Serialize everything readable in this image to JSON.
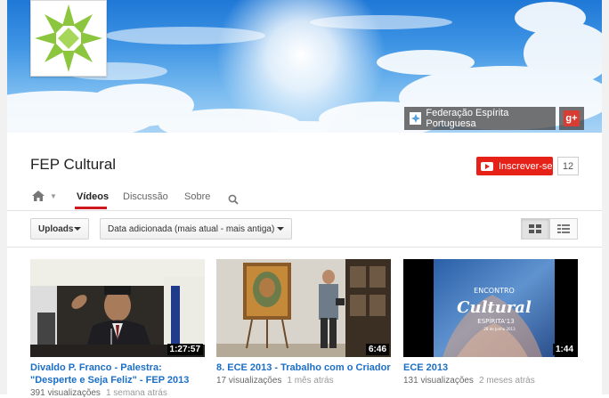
{
  "banner": {
    "link_label": "Federação Espírita Portuguesa",
    "gplus_label": "g+"
  },
  "channel": {
    "title": "FEP Cultural",
    "subscribe_label": "Inscrever-se",
    "subscriber_count": "12"
  },
  "tabs": {
    "items": [
      {
        "label": "Vídeos",
        "active": true
      },
      {
        "label": "Discussão",
        "active": false
      },
      {
        "label": "Sobre",
        "active": false
      }
    ]
  },
  "toolbar": {
    "uploads_label": "Uploads",
    "sort_label": "Data adicionada (mais atual - mais antiga)"
  },
  "videos": [
    {
      "title": "Divaldo P. Franco - Palestra: \"Desperte e Seja Feliz\" - FEP 2013",
      "duration": "1:27:57",
      "views": "391 visualizações",
      "age": "1 semana atrás"
    },
    {
      "title": "8. ECE 2013 - Trabalho com o Criador",
      "duration": "6:46",
      "views": "17 visualizações",
      "age": "1 mês atrás"
    },
    {
      "title": "ECE 2013",
      "duration": "1:44",
      "views": "131 visualizações",
      "age": "2 meses atrás",
      "thumb_text": {
        "line1": "ENCONTRO",
        "line2": "Cultural",
        "line3": "ESPÍRITA'13",
        "line4": "28 de Junho 2013"
      }
    }
  ],
  "colors": {
    "accent_red": "#cc181e",
    "subscribe_red": "#e62117",
    "link_blue": "#1b6fc7",
    "logo_green": "#8cc63f"
  }
}
